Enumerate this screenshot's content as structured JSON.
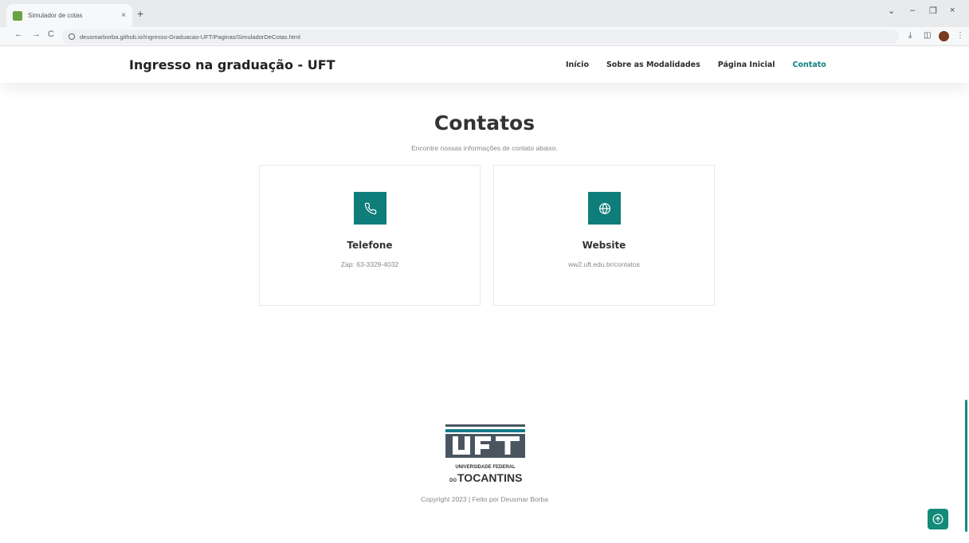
{
  "browser": {
    "tab_title": "Simulador de cotas",
    "tab_close": "×",
    "new_tab": "+",
    "url": "deusmarborba.github.io/Ingresso-Graduacao-UFT/Paginas/SimuladorDeCotas.html",
    "back": "←",
    "forward": "→",
    "reload": "C",
    "download": "⤓",
    "sidebar": "◫",
    "menu": "⋮",
    "win_chevron": "⌄",
    "win_min": "–",
    "win_max": "❐",
    "win_close": "×"
  },
  "header": {
    "brand": "Ingresso na graduação - UFT",
    "nav": [
      {
        "label": "Início"
      },
      {
        "label": "Sobre as Modalidades"
      },
      {
        "label": "Página Inicial"
      },
      {
        "label": "Contato"
      }
    ],
    "active_color": "#0f8080"
  },
  "main": {
    "title": "Contatos",
    "subtitle": "Encontre nossas informações de contato abaixo.",
    "cards": [
      {
        "title": "Telefone",
        "value": "Zap: 63-3329-4032",
        "icon": "phone-icon"
      },
      {
        "title": "Website",
        "value": "ww2.uft.edu.br/contatos",
        "icon": "globe-icon"
      }
    ]
  },
  "footer": {
    "logo_text": "UFT",
    "logo_line1": "UNIVERSIDADE FEDERAL",
    "logo_line2_small": "DO",
    "logo_line2": "TOCANTINS",
    "copyright": "Copyright 2023 | Feito por Deusmar Borba"
  },
  "colors": {
    "accent": "#0f7d7a",
    "back_top": "#128b79"
  }
}
